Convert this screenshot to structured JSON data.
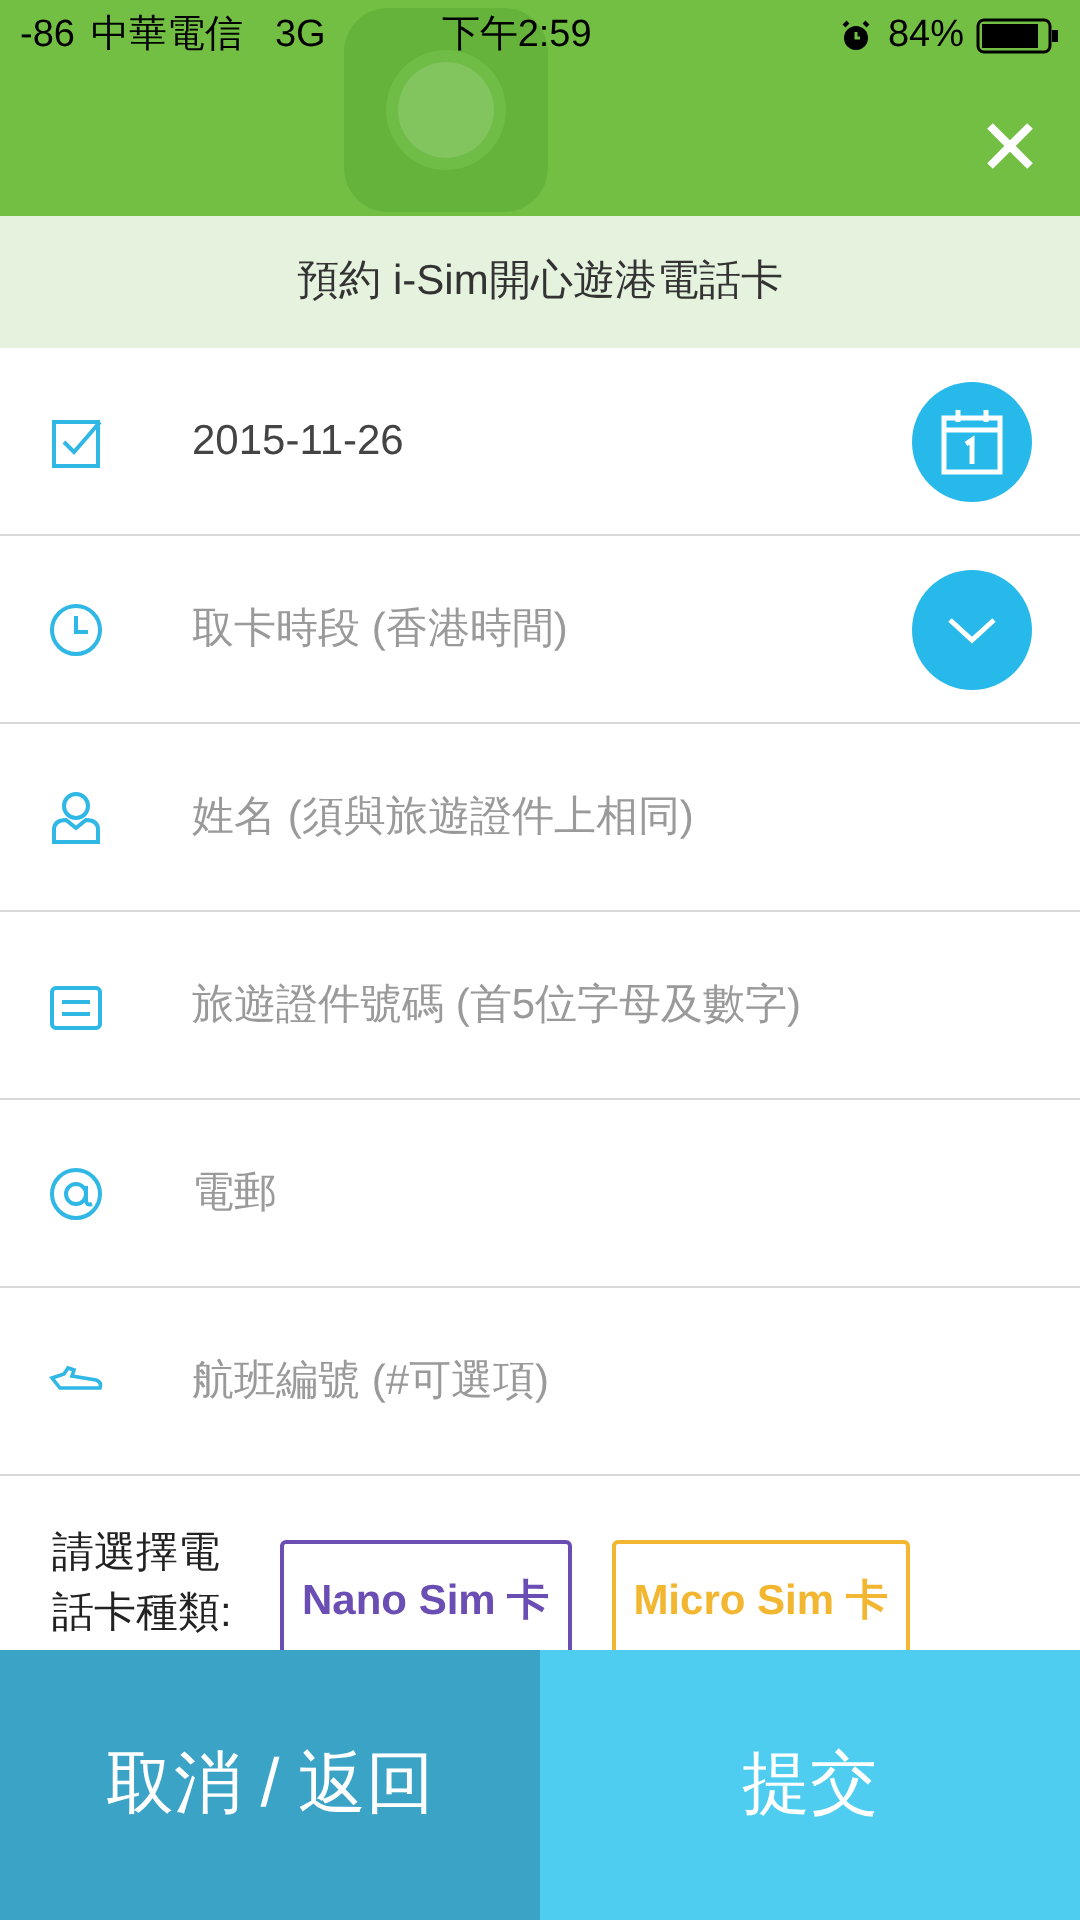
{
  "status_bar": {
    "signal": "-86",
    "carrier": "中華電信",
    "network": "3G",
    "time": "下午2:59",
    "battery": "84%"
  },
  "header": {
    "title": "預約 i-Sim開心遊港電話卡"
  },
  "fields": [
    {
      "kind": "date",
      "value": "2015-11-26"
    },
    {
      "kind": "dropdown",
      "placeholder": "取卡時段 (香港時間)"
    },
    {
      "kind": "text",
      "placeholder": "姓名 (須與旅遊證件上相同)"
    },
    {
      "kind": "text",
      "placeholder": "旅遊證件號碼 (首5位字母及數字)"
    },
    {
      "kind": "text",
      "placeholder": "電郵"
    },
    {
      "kind": "text",
      "placeholder": "航班編號 (#可選項)"
    }
  ],
  "sim_type": {
    "label": "請選擇電話卡種類:",
    "options": [
      {
        "label": "Nano Sim 卡",
        "color": "#6b4eb3",
        "selected": false
      },
      {
        "label": "Micro Sim 卡",
        "color": "#f2b630",
        "selected": false
      }
    ]
  },
  "buttons": [
    {
      "kind": "cancel",
      "label": "取消 / 返回"
    },
    {
      "kind": "submit",
      "label": "提交"
    }
  ]
}
